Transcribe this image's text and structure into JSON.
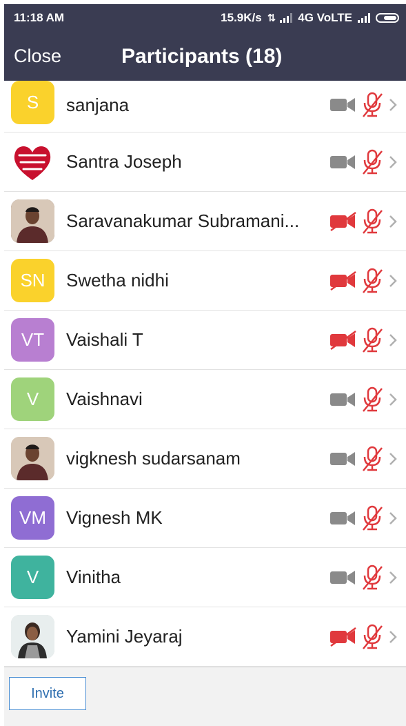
{
  "status": {
    "time": "11:18 AM",
    "speed": "15.9K/s",
    "network": "4G VoLTE"
  },
  "header": {
    "close_label": "Close",
    "title": "Participants (18)"
  },
  "participants": [
    {
      "initials": "S",
      "name": "sanjana",
      "color": "#fad22c",
      "photo": false,
      "video_off": false,
      "mic_muted": true
    },
    {
      "initials": "",
      "name": "Santra Joseph",
      "color": "#ffffff",
      "photo": "jesus-loves-you-heart",
      "video_off": false,
      "mic_muted": true
    },
    {
      "initials": "",
      "name": "Saravanakumar Subramani...",
      "color": "#6b4a3a",
      "photo": "man-portrait",
      "video_off": true,
      "mic_muted": true
    },
    {
      "initials": "SN",
      "name": "Swetha nidhi",
      "color": "#fad22c",
      "photo": false,
      "video_off": true,
      "mic_muted": true
    },
    {
      "initials": "VT",
      "name": "Vaishali T",
      "color": "#b87fd1",
      "photo": false,
      "video_off": true,
      "mic_muted": true
    },
    {
      "initials": "V",
      "name": "Vaishnavi",
      "color": "#9fd37b",
      "photo": false,
      "video_off": false,
      "mic_muted": true
    },
    {
      "initials": "",
      "name": "vigknesh sudarsanam",
      "color": "#d9cbbf",
      "photo": "man-portrait",
      "video_off": false,
      "mic_muted": true
    },
    {
      "initials": "VM",
      "name": "Vignesh MK",
      "color": "#8f6dd3",
      "photo": false,
      "video_off": false,
      "mic_muted": true
    },
    {
      "initials": "V",
      "name": "Vinitha",
      "color": "#3fb39e",
      "photo": false,
      "video_off": false,
      "mic_muted": true
    },
    {
      "initials": "",
      "name": "Yamini Jeyaraj",
      "color": "#cfd8d8",
      "photo": "woman-portrait",
      "video_off": true,
      "mic_muted": true
    }
  ],
  "footer": {
    "invite_label": "Invite"
  },
  "colors": {
    "header_bg": "#3a3c52",
    "muted_red": "#e0393d",
    "camera_gray": "#8a8a8a",
    "chevron_gray": "#b0b0b0",
    "invite_blue": "#4a8ed3"
  }
}
